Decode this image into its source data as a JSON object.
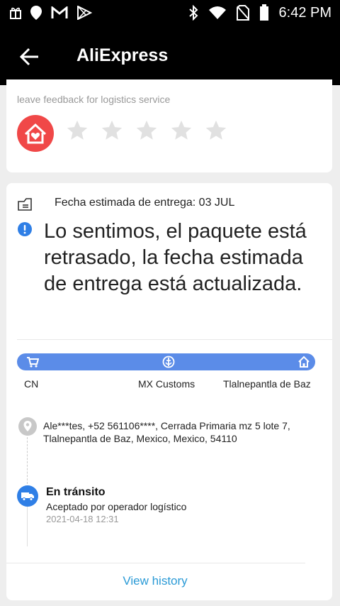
{
  "status_bar": {
    "time": "6:42 PM",
    "left_icons": [
      "gift-icon",
      "location-icon",
      "gmail-icon",
      "play-store-icon"
    ],
    "right_icons": [
      "bluetooth-icon",
      "wifi-icon",
      "no-sim-icon",
      "battery-icon"
    ]
  },
  "app_bar": {
    "title": "AliExpress",
    "back_icon": "back-arrow-icon"
  },
  "feedback": {
    "label": "leave feedback for logistics service",
    "icon": "house-heart-icon",
    "rating": 0,
    "max_rating": 5
  },
  "delivery": {
    "estimate_text": "Fecha estimada de entrega: 03 JUL",
    "delay_message": "Lo sentimos, el paquete está retrasado, la fecha estimada de entrega está actualizada.",
    "stages": [
      {
        "label": "CN",
        "icon": "cart-icon"
      },
      {
        "label": "MX Customs",
        "icon": "customs-icon"
      },
      {
        "label": "Tlalnepantla de Baz",
        "icon": "home-icon"
      }
    ],
    "address": "Ale***tes,  +52 561106****,  Cerrada Primaria mz 5 lote 7,  Tlalnepantla de Baz,  Mexico,  Mexico,  54110",
    "latest_event": {
      "title": "En tránsito",
      "description": "Aceptado por operador logístico",
      "time": "2021-04-18 12:31"
    },
    "view_history": "View history"
  },
  "colors": {
    "header": "#000000",
    "accent_blue": "#2f7fe6",
    "progress_bar": "#5b8ce8",
    "logistics_red": "#f04848",
    "link": "#2a9ad6"
  }
}
